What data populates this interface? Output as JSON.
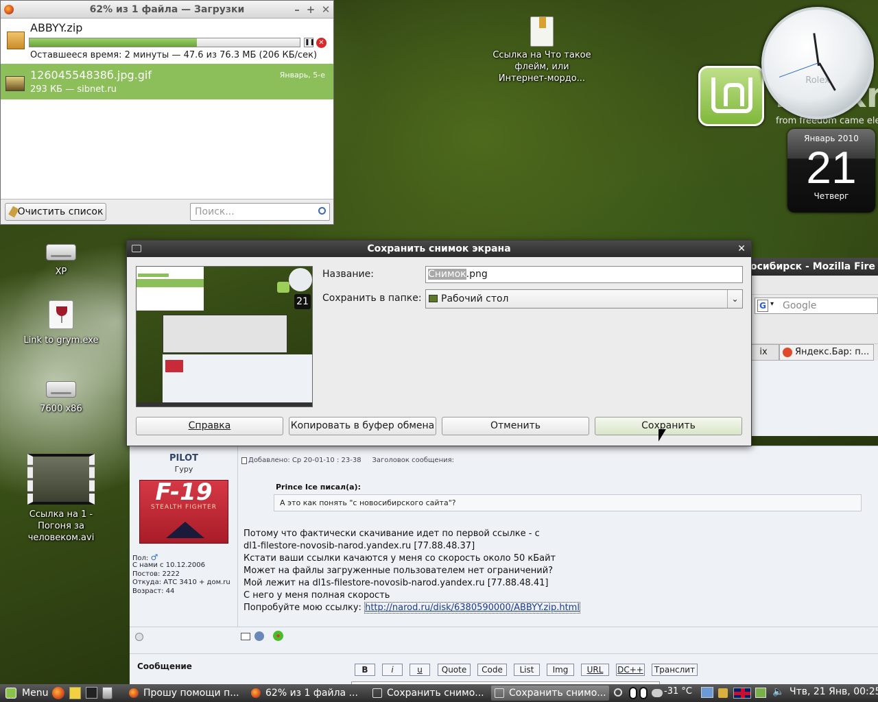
{
  "downloads": {
    "title": "62% из 1 файла — Загрузки",
    "items": [
      {
        "name": "ABBYY.zip",
        "status": "Оставшееся время: 2 минуты — 47.6 из 76.3 МБ (206 КБ/сек)",
        "progress_percent": 62
      },
      {
        "name": "12604554838б.jpg.gif",
        "status": "293 КБ — sibnet.ru",
        "date": "Январь, 5-е"
      }
    ],
    "clear_label": "Очистить список",
    "search_placeholder": "Поиск..."
  },
  "desktop": {
    "icons": [
      {
        "label": "Ссылка на Что такое флейм, или Интернет-мордо..."
      },
      {
        "label": "XP"
      },
      {
        "label": "Link to grym.exe"
      },
      {
        "label": "7600 x86"
      },
      {
        "label": "Ссылка на 1 - Погоня за человеком.avi"
      }
    ],
    "mint_tagline": "from freedom came ele",
    "clock_brand": "Rolex",
    "calendar": {
      "month": "Январь 2010",
      "day": "21",
      "weekday": "Четверг"
    }
  },
  "firefox": {
    "title_fragment": "осибирск - Mozilla Fire",
    "search_placeholder": "Google",
    "tab_fragment": "ix",
    "yandex_tab": "Яндекс.Бар: п..."
  },
  "dialog": {
    "title": "Сохранить снимок экрана",
    "name_label": "Название:",
    "name_selected": "Снимок",
    "name_rest": ".png",
    "folder_label": "Сохранить в папке:",
    "folder_value": "Рабочий стол",
    "buttons": {
      "help": "Справка",
      "copy": "Копировать в буфер обмена",
      "cancel": "Отменить",
      "save": "Сохранить"
    }
  },
  "post": {
    "author": "PILOT",
    "rank": "Гуру",
    "avatar_title": "F-19",
    "avatar_subtitle": "STEALTH   FIGHTER",
    "gender_label": "Пол:",
    "joined": "С нами с 10.12.2006",
    "posts": "Постов: 2222",
    "from": "Откуда: АТС 3410 + дом.ru",
    "age": "Возраст: 44",
    "meta": "Добавлено: Ср 20-01-10 : 23-38     Заголовок сообщения:",
    "quote_author": "Prince Ice писал(а):",
    "quote_text": "А это как понять \"с новосибирского сайта\"?",
    "lines": [
      "Потому что фактически скачивание идет по первой ссылке - с",
      "dl1-filestore-novosib-narod.yandex.ru [77.88.48.37]",
      "Кстати ваши ссылки качаются у меня со скорость около 50 кБайт",
      "Может на файлы загруженные пользователем нет ограничений?",
      "Мой лежит на dl1s-filestore-novosib-narod.yandex.ru [77.88.48.41]",
      "С него у меня полная скорость"
    ],
    "try_text": "Попробуйте мою ссылку:",
    "link": "http://narod.ru/disk/6380590000/ABBYY.zip.html",
    "message_label": "Сообщение",
    "format_buttons": [
      "B",
      "i",
      "u",
      "Quote",
      "Code",
      "List",
      "Img",
      "URL",
      "DC++",
      "Транслит"
    ]
  },
  "taskbar": {
    "menu_label": "Menu",
    "tasks": [
      {
        "label": "Прошу помощи п..."
      },
      {
        "label": "62% из 1 файла ..."
      },
      {
        "label": "Сохранить снимо..."
      },
      {
        "label": "Сохранить снимо..."
      }
    ],
    "temperature": "-31 °C",
    "datetime": "Чтв, 21 Янв, 00:25"
  }
}
